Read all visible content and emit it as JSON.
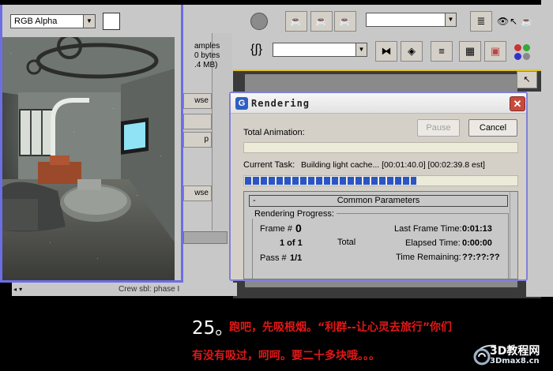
{
  "vfb": {
    "channel_select": "RGB Alpha",
    "side_texts": [
      "amples",
      "0 bytes",
      ".4 MB)"
    ],
    "side_buttons": [
      "wse",
      "p",
      "wse"
    ]
  },
  "max_status": "Crew sbl: phase I",
  "render_dialog": {
    "title": "Rendering",
    "total_animation_label": "Total Animation:",
    "pause_label": "Pause",
    "cancel_label": "Cancel",
    "current_task_label": "Current Task:",
    "current_task_value": "Building light cache... [00:01:40.0] [00:02:39.8 est]",
    "task_progress": 0.63,
    "common_parameters_label": "Common Parameters",
    "rendering_progress_label": "Rendering Progress:",
    "frame_label": "Frame #",
    "frame_value": "0",
    "frame_count": "1 of 1",
    "total_label": "Total",
    "pass_label": "Pass #",
    "pass_value": "1/1",
    "last_frame_time_label": "Last Frame Time:",
    "last_frame_time_value": "0:01:13",
    "elapsed_time_label": "Elapsed Time:",
    "elapsed_time_value": "0:00:00",
    "time_remaining_label": "Time Remaining:",
    "time_remaining_value": "??:??:??"
  },
  "caption": {
    "number": "25。",
    "line1": "跑吧，先吸根烟。“利群--让心灵去旅行”你们",
    "line2": "有没有吸过，呵呵。要二十多块哦。。。"
  },
  "watermark": {
    "line1": "3D教程网",
    "line2": "3Dmax8.cn"
  }
}
